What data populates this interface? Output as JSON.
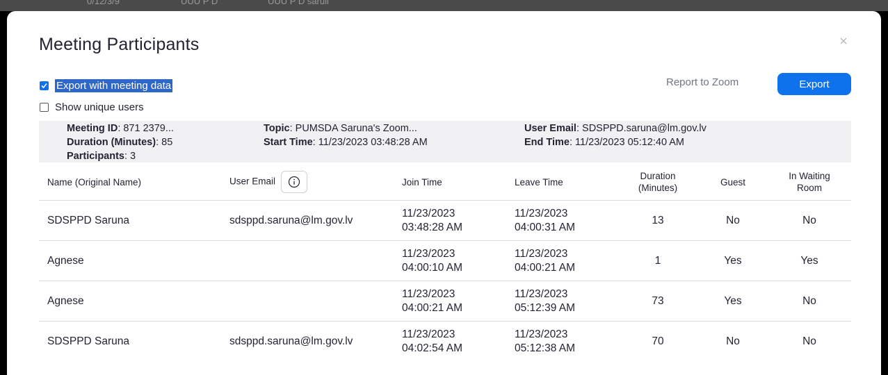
{
  "background": {
    "snippets": [
      "0/12/3/9",
      "UUU P D",
      "UUU P D saruii"
    ]
  },
  "dialog": {
    "title": "Meeting Participants",
    "close_glyph": "×",
    "options": {
      "export_with_meeting_data": {
        "label": "Export with meeting data",
        "checked": true
      },
      "show_unique_users": {
        "label": "Show unique users",
        "checked": false
      }
    },
    "report_link": "Report to Zoom",
    "export_button": "Export",
    "summary": {
      "meeting_id": {
        "label": "Meeting ID",
        "value": ": 871 2379..."
      },
      "duration": {
        "label": "Duration (Minutes)",
        "value": ": 85"
      },
      "participants": {
        "label": "Participants",
        "value": ": 3"
      },
      "topic": {
        "label": "Topic",
        "value": ": PUMSDA Saruna's Zoom..."
      },
      "start_time": {
        "label": "Start Time",
        "value": ": 11/23/2023 03:48:28 AM"
      },
      "user_email": {
        "label": "User Email",
        "value": ": SDSPPD.saruna@lm.gov.lv"
      },
      "end_time": {
        "label": "End Time",
        "value": ": 11/23/2023 05:12:40 AM"
      }
    },
    "table": {
      "headers": {
        "name": "Name (Original Name)",
        "email": "User Email",
        "join": "Join Time",
        "leave": "Leave Time",
        "duration_1": "Duration",
        "duration_2": "(Minutes)",
        "guest": "Guest",
        "waiting_1": "In Waiting",
        "waiting_2": "Room"
      },
      "rows": [
        {
          "name": "SDSPPD Saruna",
          "email": "sdsppd.saruna@lm.gov.lv",
          "join_date": "11/23/2023",
          "join_time": "03:48:28 AM",
          "leave_date": "11/23/2023",
          "leave_time": "04:00:31 AM",
          "duration": "13",
          "guest": "No",
          "waiting": "No"
        },
        {
          "name": "Agnese",
          "email": "",
          "join_date": "11/23/2023",
          "join_time": "04:00:10 AM",
          "leave_date": "11/23/2023",
          "leave_time": "04:00:21 AM",
          "duration": "1",
          "guest": "Yes",
          "waiting": "Yes"
        },
        {
          "name": "Agnese",
          "email": "",
          "join_date": "11/23/2023",
          "join_time": "04:00:21 AM",
          "leave_date": "11/23/2023",
          "leave_time": "05:12:39 AM",
          "duration": "73",
          "guest": "Yes",
          "waiting": "No"
        },
        {
          "name": "SDSPPD Saruna",
          "email": "sdsppd.saruna@lm.gov.lv",
          "join_date": "11/23/2023",
          "join_time": "04:02:54 AM",
          "leave_date": "11/23/2023",
          "leave_time": "05:12:38 AM",
          "duration": "70",
          "guest": "No",
          "waiting": "No"
        }
      ]
    },
    "colors": {
      "accent": "#0e72ed",
      "selection": "#2f67c9",
      "summary_bg": "#f1f1f4"
    }
  }
}
